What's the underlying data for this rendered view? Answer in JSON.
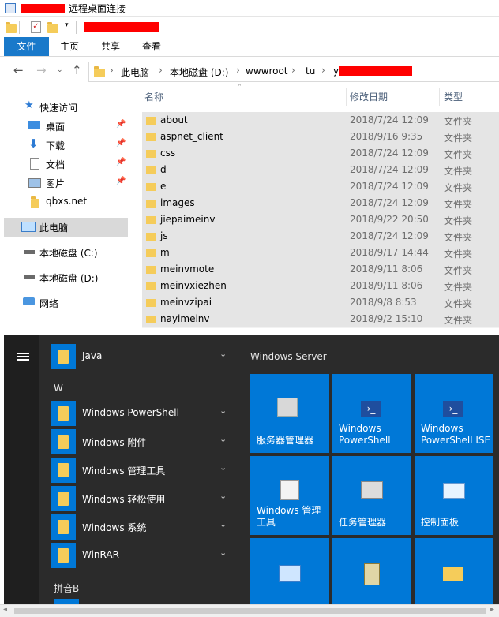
{
  "window": {
    "title": "远程桌面连接"
  },
  "ribbon": {
    "tabs": [
      "文件",
      "主页",
      "共享",
      "查看"
    ]
  },
  "address": {
    "crumbs": [
      "此电脑",
      "本地磁盘 (D:)",
      "wwwroot",
      "tu",
      "y"
    ]
  },
  "nav": {
    "items": [
      {
        "label": "快速访问",
        "icon": "star-icon",
        "pinned": false
      },
      {
        "label": "桌面",
        "icon": "desktop-icon",
        "pinned": true
      },
      {
        "label": "下载",
        "icon": "download-icon",
        "pinned": true
      },
      {
        "label": "文档",
        "icon": "document-icon",
        "pinned": true
      },
      {
        "label": "图片",
        "icon": "picture-icon",
        "pinned": true
      },
      {
        "label": "qbxs.net",
        "icon": "folder-icon",
        "pinned": false
      },
      {
        "label": "此电脑",
        "icon": "computer-icon",
        "pinned": false
      },
      {
        "label": "本地磁盘 (C:)",
        "icon": "drive-icon",
        "pinned": false
      },
      {
        "label": "本地磁盘 (D:)",
        "icon": "drive-icon",
        "pinned": false
      },
      {
        "label": "网络",
        "icon": "network-icon",
        "pinned": false
      }
    ]
  },
  "filelist": {
    "columns": [
      "名称",
      "修改日期",
      "类型"
    ],
    "rows": [
      {
        "name": "about",
        "date": "2018/7/24 12:09",
        "type": "文件夹"
      },
      {
        "name": "aspnet_client",
        "date": "2018/9/16 9:35",
        "type": "文件夹"
      },
      {
        "name": "css",
        "date": "2018/7/24 12:09",
        "type": "文件夹"
      },
      {
        "name": "d",
        "date": "2018/7/24 12:09",
        "type": "文件夹"
      },
      {
        "name": "e",
        "date": "2018/7/24 12:09",
        "type": "文件夹"
      },
      {
        "name": "images",
        "date": "2018/7/24 12:09",
        "type": "文件夹"
      },
      {
        "name": "jiepaimeinv",
        "date": "2018/9/22 20:50",
        "type": "文件夹"
      },
      {
        "name": "js",
        "date": "2018/7/24 12:09",
        "type": "文件夹"
      },
      {
        "name": "m",
        "date": "2018/9/17 14:44",
        "type": "文件夹"
      },
      {
        "name": "meinvmote",
        "date": "2018/9/11 8:06",
        "type": "文件夹"
      },
      {
        "name": "meinvxiezhen",
        "date": "2018/9/11 8:06",
        "type": "文件夹"
      },
      {
        "name": "meinvzipai",
        "date": "2018/9/8 8:53",
        "type": "文件夹"
      },
      {
        "name": "nayimeinv",
        "date": "2018/9/2 15:10",
        "type": "文件夹"
      }
    ]
  },
  "startmenu": {
    "apps": [
      {
        "label": "Java"
      },
      {
        "label": "Windows PowerShell"
      },
      {
        "label": "Windows 附件"
      },
      {
        "label": "Windows 管理工具"
      },
      {
        "label": "Windows 轻松使用"
      },
      {
        "label": "Windows 系统"
      },
      {
        "label": "WinRAR"
      }
    ],
    "section_w": "W",
    "section_pinyin": "拼音B",
    "tiles_header": "Windows Server",
    "tiles": [
      {
        "label": "服务器管理器",
        "icon": "server-manager-icon"
      },
      {
        "label": "Windows PowerShell",
        "icon": "powershell-icon"
      },
      {
        "label": "Windows PowerShell ISE",
        "icon": "powershell-ise-icon"
      },
      {
        "label": "Windows 管理工具",
        "icon": "admin-tools-icon"
      },
      {
        "label": "任务管理器",
        "icon": "task-manager-icon"
      },
      {
        "label": "控制面板",
        "icon": "control-panel-icon"
      }
    ]
  },
  "colors": {
    "accent": "#0078d7",
    "ribbon_file": "#1979ca",
    "redaction": "#ff0000",
    "folder": "#f5cc5a"
  }
}
